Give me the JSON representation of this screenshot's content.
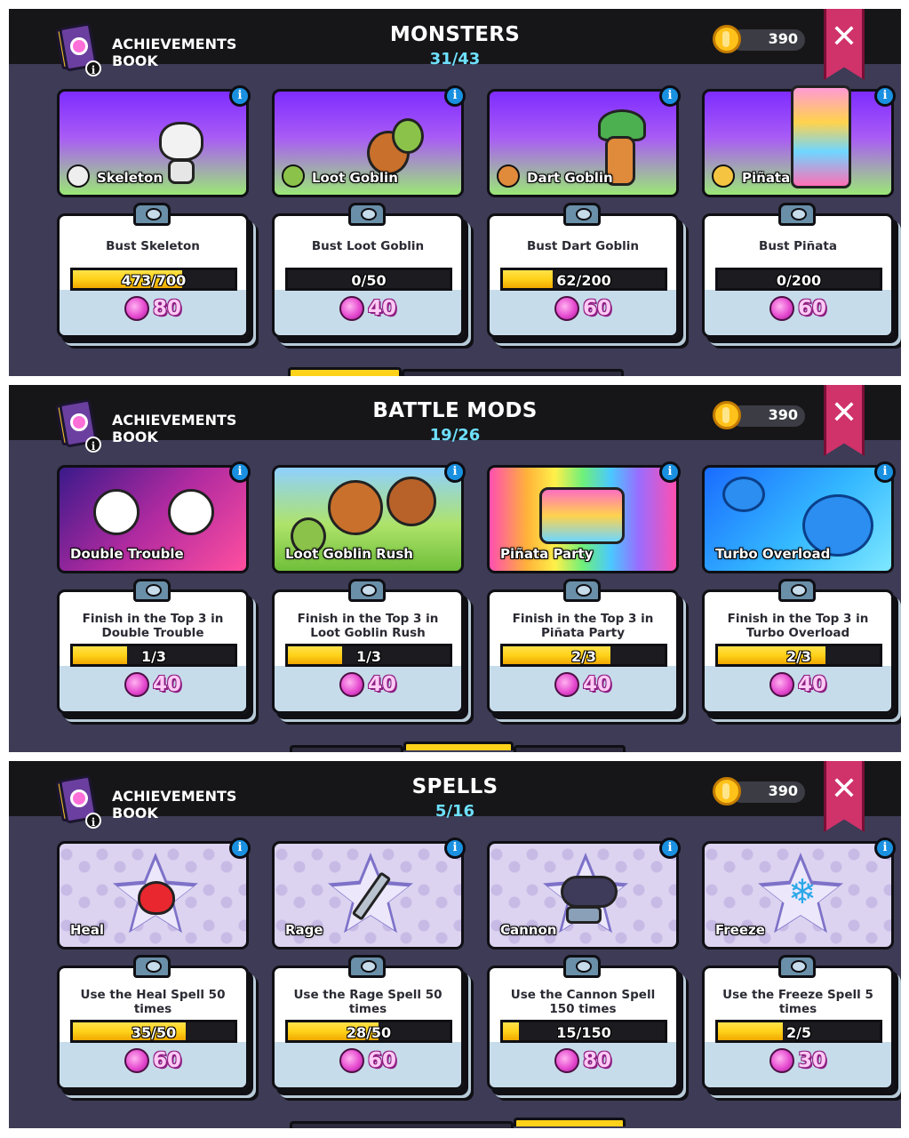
{
  "header": {
    "book_title_line1": "ACHIEVEMENTS",
    "book_title_line2": "BOOK",
    "info_glyph": "i",
    "close_glyph": "✕"
  },
  "panels": [
    {
      "title": "MONSTERS",
      "count": "31/43",
      "coins": "390",
      "cards": [
        {
          "name": "Skeleton",
          "task": "Bust Skeleton",
          "progress": "473/700",
          "fraction": 0.676,
          "reward": "80"
        },
        {
          "name": "Loot Goblin",
          "task": "Bust Loot Goblin",
          "progress": "0/50",
          "fraction": 0,
          "reward": "40"
        },
        {
          "name": "Dart Goblin",
          "task": "Bust Dart Goblin",
          "progress": "62/200",
          "fraction": 0.31,
          "reward": "60"
        },
        {
          "name": "Piñata",
          "task": "Bust Piñata",
          "progress": "0/200",
          "fraction": 0,
          "reward": "60"
        }
      ]
    },
    {
      "title": "BATTLE MODS",
      "count": "19/26",
      "coins": "390",
      "cards": [
        {
          "name": "Double Trouble",
          "task": "Finish in the Top 3 in Double Trouble",
          "progress": "1/3",
          "fraction": 0.333,
          "reward": "40"
        },
        {
          "name": "Loot Goblin Rush",
          "task": "Finish in the Top 3 in Loot Goblin Rush",
          "progress": "1/3",
          "fraction": 0.333,
          "reward": "40"
        },
        {
          "name": "Piñata Party",
          "task": "Finish in the Top 3 in Piñata Party",
          "progress": "2/3",
          "fraction": 0.667,
          "reward": "40"
        },
        {
          "name": "Turbo Overload",
          "task": "Finish in the Top 3 in Turbo Overload",
          "progress": "2/3",
          "fraction": 0.667,
          "reward": "40"
        }
      ]
    },
    {
      "title": "SPELLS",
      "count": "5/16",
      "coins": "390",
      "cards": [
        {
          "name": "Heal",
          "task": "Use the Heal Spell 50 times",
          "progress": "35/50",
          "fraction": 0.7,
          "reward": "60"
        },
        {
          "name": "Rage",
          "task": "Use the Rage Spell 50 times",
          "progress": "28/50",
          "fraction": 0.56,
          "reward": "60"
        },
        {
          "name": "Cannon",
          "task": "Use the Cannon Spell 150 times",
          "progress": "15/150",
          "fraction": 0.1,
          "reward": "80"
        },
        {
          "name": "Freeze",
          "task": "Use the Freeze Spell 5 times",
          "progress": "2/5",
          "fraction": 0.4,
          "reward": "30"
        }
      ]
    }
  ],
  "colors": {
    "progress_fill": "#ffd21a",
    "gem": "#e64bd0",
    "count": "#6ee0ff",
    "close": "#d0326a",
    "info": "#1a90e0"
  }
}
